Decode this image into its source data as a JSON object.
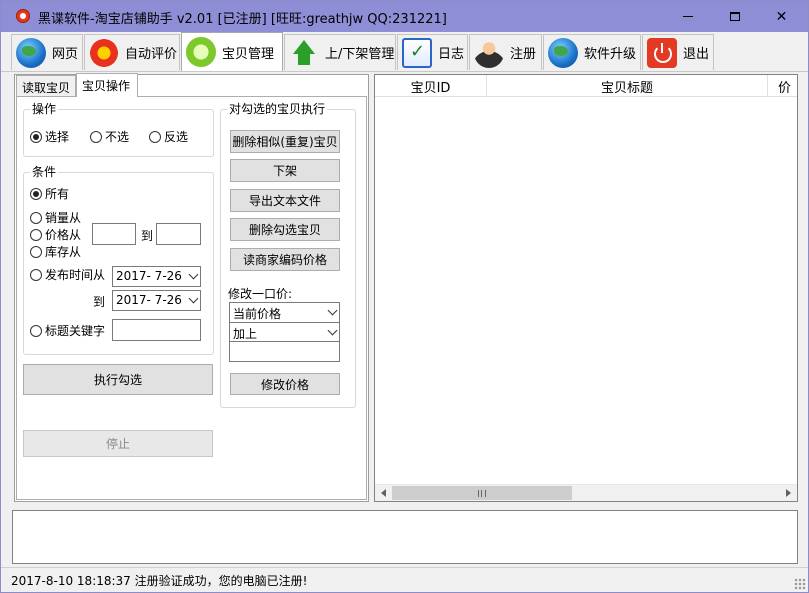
{
  "window": {
    "title": "黑谍软件-淘宝店铺助手  v2.01 [已注册] [旺旺:greathjw QQ:231221]",
    "minimize_label": "",
    "maximize_label": "",
    "close_label": "✕"
  },
  "toolbar": {
    "tabs": [
      {
        "label": "网页",
        "icon": "globe-icon"
      },
      {
        "label": "自动评价",
        "icon": "flower-icon"
      },
      {
        "label": "宝贝管理",
        "icon": "lime-icon",
        "active": true
      },
      {
        "label": "上/下架管理",
        "icon": "up-down-arrow-icon"
      },
      {
        "label": "日志",
        "icon": "log-notebook-icon"
      },
      {
        "label": "注册",
        "icon": "user-key-icon"
      },
      {
        "label": "软件升级",
        "icon": "globe-icon"
      },
      {
        "label": "退出",
        "icon": "power-icon"
      }
    ]
  },
  "subtabs": [
    {
      "label": "读取宝贝",
      "active": false
    },
    {
      "label": "宝贝操作",
      "active": true
    }
  ],
  "operation": {
    "title": "操作",
    "options": [
      "选择",
      "不选",
      "反选"
    ],
    "selected": "选择"
  },
  "conditions": {
    "title": "条件",
    "all_label": "所有",
    "sales_label": "销量从",
    "price_label": "价格从",
    "stock_label": "库存从",
    "to_label": "到",
    "range_from_value": "",
    "range_to_value": "",
    "publish_label": "发布时间从",
    "publish_to_label": "到",
    "publish_from_date": "2017-  7-26",
    "publish_to_date": "2017-  7-26",
    "keyword_label": "标题关键字",
    "keyword_value": "",
    "selected": "所有"
  },
  "actions": {
    "execute_label": "执行勾选",
    "stop_label": "停止"
  },
  "selected_items": {
    "title": "对勾选的宝贝执行",
    "buttons": [
      "删除相似(重复)宝贝",
      "下架",
      "导出文本文件",
      "删除勾选宝贝",
      "读商家编码价格"
    ],
    "price_label": "修改一口价:",
    "price_base": "当前价格",
    "price_op": "加上",
    "price_value": "",
    "modify_label": "修改价格"
  },
  "table": {
    "columns": [
      "宝贝ID",
      "宝贝标题",
      "价"
    ],
    "rows": []
  },
  "log": {
    "text": ""
  },
  "status": {
    "text": "2017-8-10 18:18:37  注册验证成功，您的电脑已注册!"
  },
  "colors": {
    "titlebar": "#8e8ed6",
    "window_bg": "#f0f0f0",
    "exit_icon": "#e33a24"
  }
}
